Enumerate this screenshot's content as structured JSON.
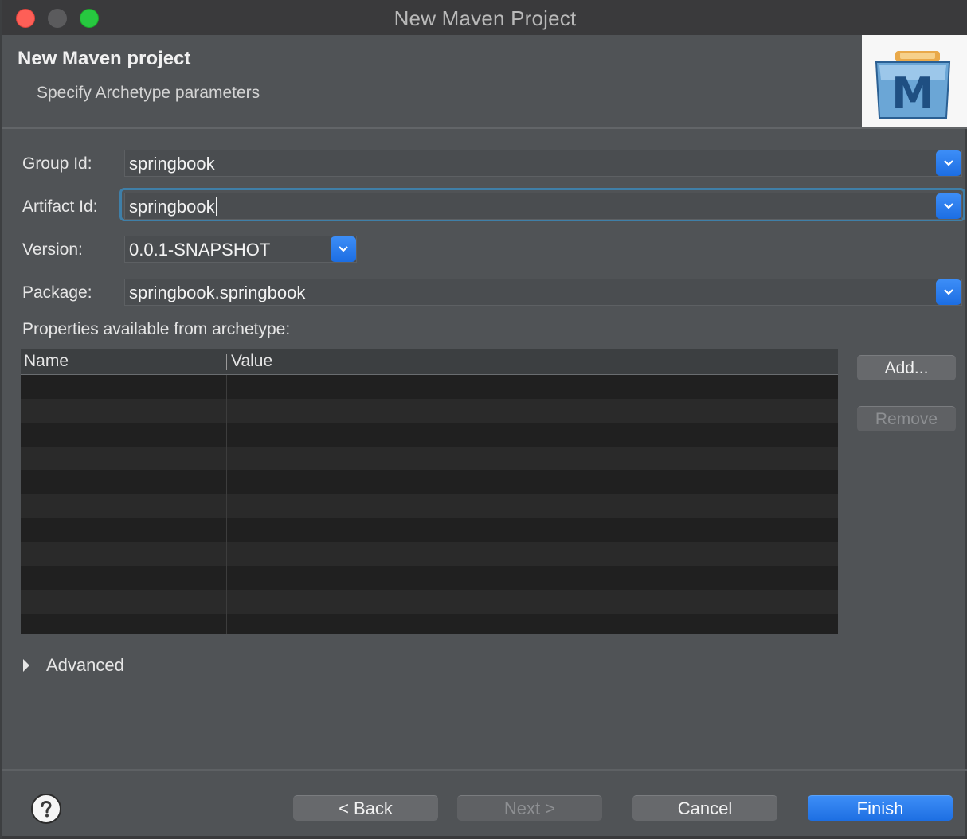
{
  "window": {
    "title": "New Maven Project"
  },
  "banner": {
    "title": "New Maven project",
    "subtitle": "Specify Archetype parameters",
    "image_icon": "maven-logo-icon",
    "image_letter": "M"
  },
  "form": {
    "group_id": {
      "label": "Group Id:",
      "value": "springbook"
    },
    "artifact_id": {
      "label": "Artifact Id:",
      "value": "springbook"
    },
    "version": {
      "label": "Version:",
      "value": "0.0.1-SNAPSHOT"
    },
    "package": {
      "label": "Package:",
      "value": "springbook.springbook"
    }
  },
  "properties": {
    "label": "Properties available from archetype:",
    "columns": [
      "Name",
      "Value"
    ],
    "rows": []
  },
  "side_buttons": {
    "add_label": "Add...",
    "remove_label": "Remove"
  },
  "advanced": {
    "label": "Advanced",
    "expanded": false
  },
  "footer": {
    "help_icon": "help-icon",
    "back_label": "< Back",
    "next_label": "Next >",
    "cancel_label": "Cancel",
    "finish_label": "Finish"
  },
  "colors": {
    "accent": "#1c6ee3",
    "focus_ring": "#3f7fa8",
    "panel": "#505356",
    "table_background": "#202020"
  }
}
